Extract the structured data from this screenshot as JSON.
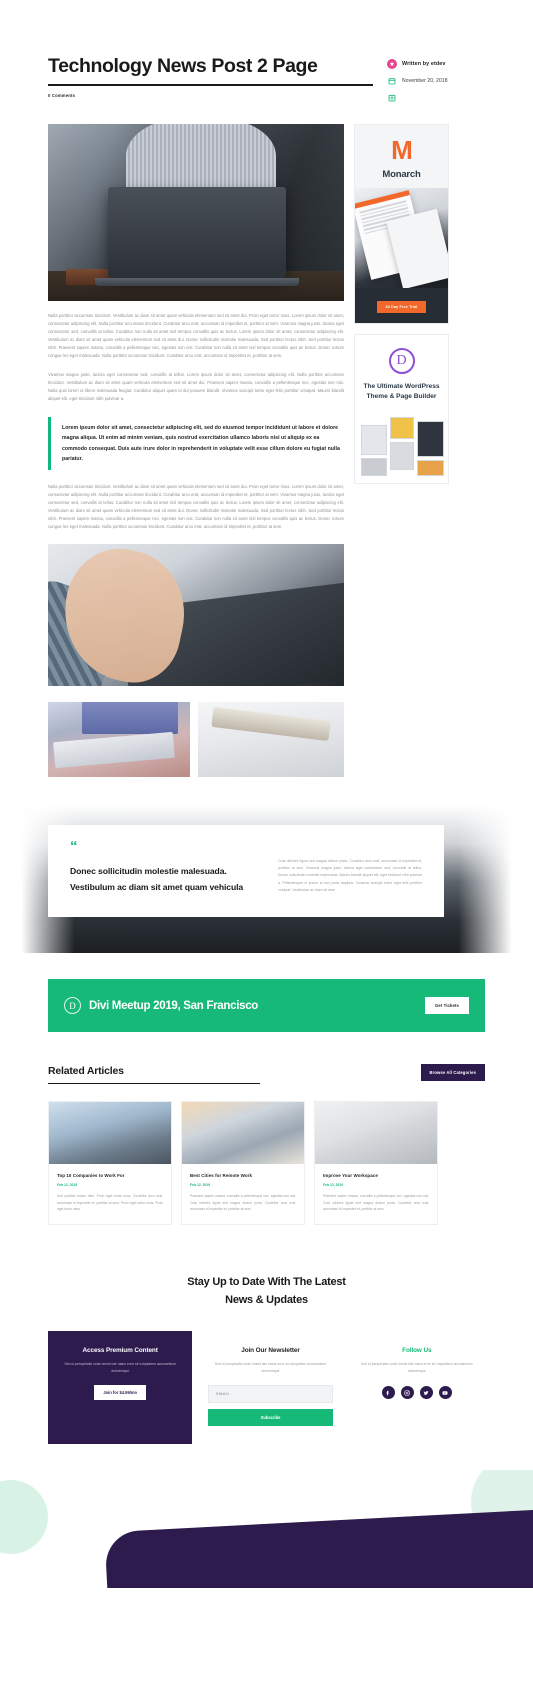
{
  "header": {
    "title": "Technology News Post 2 Page",
    "comments": "0 Comments",
    "author_label": "Written by etdev",
    "date": "November 20, 2018",
    "category": ""
  },
  "article": {
    "paragraph1": "Nulla porttitor accumsan tincidunt. Vestibulum ac diam sit amet quam vehicula elementum sed sit amet dui. Proin eget tortor risus. Lorem ipsum dolor sit amet, consectetur adipiscing elit. Nulla porttitor accumsan tincidunt. Curabitur arcu erat, accumsan id imperdiet et, porttitor at sem. Vivamus magna justo, lacinia eget consectetur sed, convallis at tellus. Curabitur non nulla sit amet nisl tempus convallis quis ac lectus. Lorem ipsum dolor sit amet, consectetur adipiscing elit. Vestibulum ac diam sit amet quam vehicula elementum sed sit amet dui. Donec sollicitudin molestie malesuada. Sed porttitor lectus nibh. Sed porttitor lectus nibh. Praesent sapien massa, convallis a pellentesque nec, egestas non nisi. Curabitur non nulla sit amet nisl tempus convallis quis ac lectus. Donec rutrum congue leo eget malesuada. Nulla porttitor accumsan tincidunt. Curabitur arcu erat, accumsan id imperdiet et, porttitor at sem.",
    "paragraph2": "Vivamus magna justo, lacinia eget consectetur sed, convallis at tellus. Lorem ipsum dolor sit amet, consectetur adipiscing elit. Nulla porttitor accumsan tincidunt. Vestibulum ac diam sit amet quam vehicula elementum sed sit amet dui. Praesent sapien massa, convallis a pellentesque nec, egestas non nisi. Nulla quis lorem ut libero malesuada feugiat. Curabitur aliquet quam id dui posuere blandit. Vivamus suscipit tortor eget felis porttitor volutpat. Mauris blandit aliquet elit, eget tincidunt nibh pulvinar a.",
    "blockquote": "Lorem ipsum dolor sit amet, consectetur adipiscing elit, sed do eiusmod tempor incididunt ut labore et dolore magna aliqua. Ut enim ad minim veniam, quis nostrud exercitation ullamco laboris nisi ut aliquip ex ea commodo consequat. Duis aute irure dolor in reprehenderit in voluptate velit esse cillum dolore eu fugiat nulla pariatur.",
    "paragraph3": "Nulla porttitor accumsan tincidunt. Vestibulum ac diam sit amet quam vehicula elementum sed sit amet dui. Proin eget tortor risus. Lorem ipsum dolor sit amet, consectetur adipiscing elit. Nulla porttitor accumsan tincidunt. Curabitur arcu erat, accumsan id imperdiet et, porttitor at sem. Vivamus magna justo, lacinia eget consectetur sed, convallis at tellus. Curabitur non nulla sit amet nisl tempus convallis quis ac lectus. Lorem ipsum dolor sit amet, consectetur adipiscing elit. Vestibulum ac diam sit amet quam vehicula elementum sed sit amet dui. Donec sollicitudin molestie malesuada. Sed porttitor lectus nibh. Sed porttitor lectus nibh. Praesent sapien massa, convallis a pellentesque nec, egestas non nisi. Curabitur non nulla sit amet nisl tempus convallis quis ac lectus. Donec rutrum congue leo eget malesuada. Nulla porttitor accumsan tincidunt. Curabitur arcu erat, accumsan id imperdiet et, porttitor at sem."
  },
  "sidebar": {
    "monarch": {
      "logo": "M",
      "name": "Monarch",
      "cta": "30 Day Free Trial"
    },
    "divi": {
      "logo": "D",
      "tagline": "The Ultimate WordPress Theme & Page Builder"
    }
  },
  "pullquote": {
    "mark": "“",
    "title": "Donec sollicitudin molestie malesuada. Vestibulum ac diam sit amet quam vehicula",
    "body": "Cras ultricies ligula sed magna dictum porta. Curabitur arcu erat, accumsan id imperdiet et, porttitor at sem. Vivamus magna justo, lacinia eget consectetur sed, convallis at tellus. Donec sollicitudin molestie malesuada. Mauris blandit aliquet elit, eget tincidunt nibh pulvinar a. Pellentesque in ipsum id orci porta dapibus. Vivamus suscipit tortor eget felis porttitor volutpat. Vestibulum ac diam sit ame"
  },
  "meetup": {
    "logo": "D",
    "title": "Divi Meetup 2019, San Francisco",
    "button": "Get Tickets"
  },
  "related": {
    "heading": "Related Articles",
    "browse_button": "Browse All Categories",
    "cards": [
      {
        "title": "Top 10 Companies to Work For",
        "date": "Feb 12, 2019",
        "text": "Sed porttitor lectus nibh. Proin eget tortor risus. Curabitur arcu erat, accumsan id imperdiet et, porttitor at sem. Proin eget tortor risus. Proin eget tortor risus."
      },
      {
        "title": "Best Cities for Remote Work",
        "date": "Feb 12, 2019",
        "text": "Praesent sapien massa, convallis a pellentesque nec, egestas non nisi. Cras ultricies ligula sed magna dictum porta. Curabitur arcu erat, accumsan id imperdiet et, porttitor at sem."
      },
      {
        "title": "Improve Your Workspace",
        "date": "Feb 12, 2019",
        "text": "Praesent sapien massa, convallis a pellentesque nec, egestas non nisi. Cras ultricies ligula sed magna dictum porta. Curabitur arcu erat, accumsan id imperdiet et, porttitor at sem."
      }
    ]
  },
  "newsletter": {
    "heading_line1": "Stay Up to Date With The Latest",
    "heading_line2": "News & Updates",
    "premium": {
      "title": "Access Premium Content",
      "text": "Sed ut perspiciatis unde omnis iste natus error sit voluptatem accusantium doloremque",
      "button": "Join for $4.99/mo"
    },
    "join": {
      "title": "Join Our Newsletter",
      "text": "Sed ut perspiciatis unde omnis iste natus error sit voluptatem accusantium doloremque",
      "email_placeholder": "EMAIL",
      "email_value": "",
      "button": "Subscribe"
    },
    "follow": {
      "title": "Follow Us",
      "text": "Sed ut perspiciatis unde omnis iste natus error sit voluptatem accusantium doloremque",
      "icons": [
        "facebook-icon",
        "instagram-icon",
        "twitter-icon",
        "youtube-icon"
      ]
    }
  },
  "colors": {
    "green": "#17b978",
    "purple": "#2d1b4e",
    "orange": "#f2682a",
    "pink": "#e6458f",
    "divi_purple": "#8f4fd6"
  }
}
